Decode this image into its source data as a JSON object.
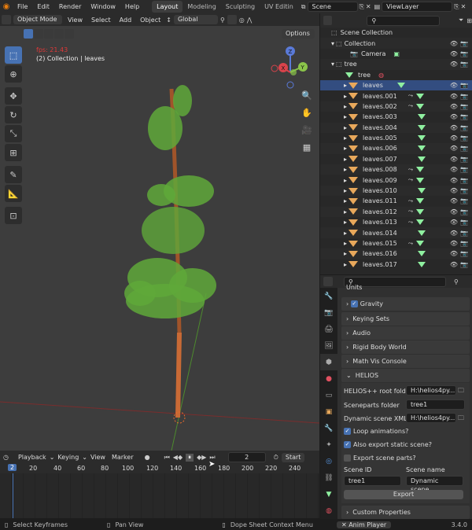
{
  "menu": [
    "File",
    "Edit",
    "Render",
    "Window",
    "Help"
  ],
  "workspace_tabs": [
    "Layout",
    "Modeling",
    "Sculpting",
    "UV Editin"
  ],
  "scene_field": "Scene",
  "viewlayer_field": "ViewLayer",
  "header3d": {
    "mode": "Object Mode",
    "items": [
      "View",
      "Select",
      "Add",
      "Object"
    ],
    "transform": "Global",
    "options": "Options"
  },
  "viewport": {
    "fps": "fps: 21.43",
    "collection": "(2) Collection | leaves",
    "axis_x": "X",
    "axis_y": "Y",
    "axis_z": "Z"
  },
  "outliner": {
    "search_placeholder": "",
    "scene_collection": "Scene Collection",
    "collection": "Collection",
    "camera": "Camera",
    "tree_collection": "tree",
    "tree_obj": "tree",
    "leaves": [
      "leaves",
      "leaves.001",
      "leaves.002",
      "leaves.003",
      "leaves.004",
      "leaves.005",
      "leaves.006",
      "leaves.007",
      "leaves.008",
      "leaves.009",
      "leaves.010",
      "leaves.011",
      "leaves.012",
      "leaves.013",
      "leaves.014",
      "leaves.015",
      "leaves.016",
      "leaves.017"
    ]
  },
  "properties": {
    "units": "Units",
    "gravity": "Gravity",
    "keying_sets": "Keying Sets",
    "audio": "Audio",
    "rigid_body": "Rigid Body World",
    "math_vis": "Math Vis Console",
    "helios": "HELIOS",
    "root_folder_label": "HELIOS++ root folder",
    "root_folder_value": "H:\\helios4py...",
    "sceneparts_label": "Sceneparts folder",
    "sceneparts_value": "tree1",
    "dynamic_xml_label": "Dynamic scene XML",
    "dynamic_xml_value": "H:\\helios4py...",
    "loop_animations": "Loop animations?",
    "export_static": "Also export static scene?",
    "export_parts": "Export scene parts?",
    "scene_id_label": "Scene ID",
    "scene_name_label": "Scene name",
    "scene_id_value": "tree1",
    "scene_name_value": "Dynamic scene",
    "export_button": "Export",
    "custom_props": "Custom Properties"
  },
  "timeline": {
    "playback": "Playback",
    "keying": "Keying",
    "view": "View",
    "marker": "Marker",
    "frame": "2",
    "start": "Start",
    "current": "2",
    "ticks": [
      "20",
      "40",
      "60",
      "80",
      "100",
      "120",
      "140",
      "160",
      "180",
      "200",
      "220",
      "240"
    ]
  },
  "status": {
    "select": "Select Keyframes",
    "pan": "Pan View",
    "context": "Dope Sheet Context Menu",
    "anim_player": "Anim Player",
    "version": "3.4.0"
  }
}
